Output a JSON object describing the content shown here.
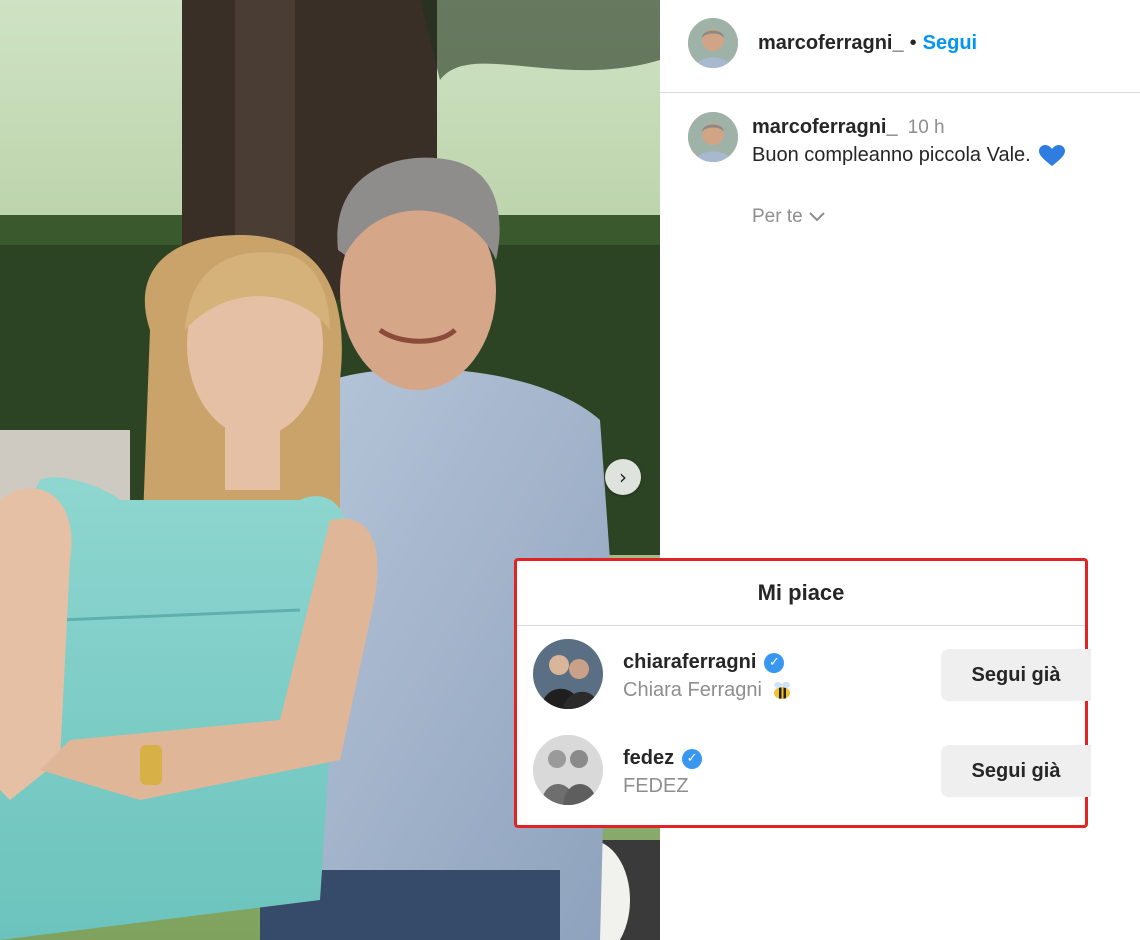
{
  "post": {
    "username": "marcoferragni_",
    "follow_label": "Segui",
    "separator": "•",
    "caption": {
      "username": "marcoferragni_",
      "time": "10 h",
      "text": "Buon compleanno piccola Vale.",
      "emoji_icon": "blue-heart-icon"
    },
    "translation_toggle": "Per te"
  },
  "likes_dialog": {
    "title": "Mi piace",
    "users": [
      {
        "username": "chiaraferragni",
        "verified": true,
        "full_name": "Chiara Ferragni",
        "suffix_icon": "bee-icon",
        "button_label": "Segui già"
      },
      {
        "username": "fedez",
        "verified": true,
        "full_name": "FEDEZ",
        "button_label": "Segui già"
      }
    ]
  },
  "colors": {
    "link_blue": "#0095f6",
    "verified_blue": "#3897f0",
    "highlight_red": "#e02424",
    "muted_text": "#8e8e8e"
  }
}
